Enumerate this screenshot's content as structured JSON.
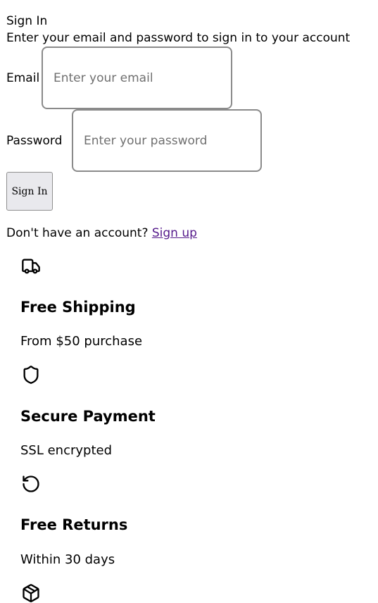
{
  "form": {
    "title": "Sign In",
    "subtitle": "Enter your email and password to sign in to your account",
    "email_label": "Email",
    "email_placeholder": "Enter your email",
    "email_value": "",
    "password_label": "Password",
    "password_placeholder": "Enter your password",
    "password_value": "",
    "submit_label": "Sign In",
    "signup_prompt": "Don't have an account?",
    "signup_link": "Sign up"
  },
  "features": [
    {
      "icon": "truck-icon",
      "title": "Free Shipping",
      "desc": "From $50 purchase"
    },
    {
      "icon": "shield-icon",
      "title": "Secure Payment",
      "desc": "SSL encrypted"
    },
    {
      "icon": "rotate-ccw-icon",
      "title": "Free Returns",
      "desc": "Within 30 days"
    },
    {
      "icon": "package-icon"
    }
  ],
  "colors": {
    "link_visited": "#551a8b",
    "button_bg": "#e9e9ed",
    "input_border": "#8a8a8a"
  }
}
